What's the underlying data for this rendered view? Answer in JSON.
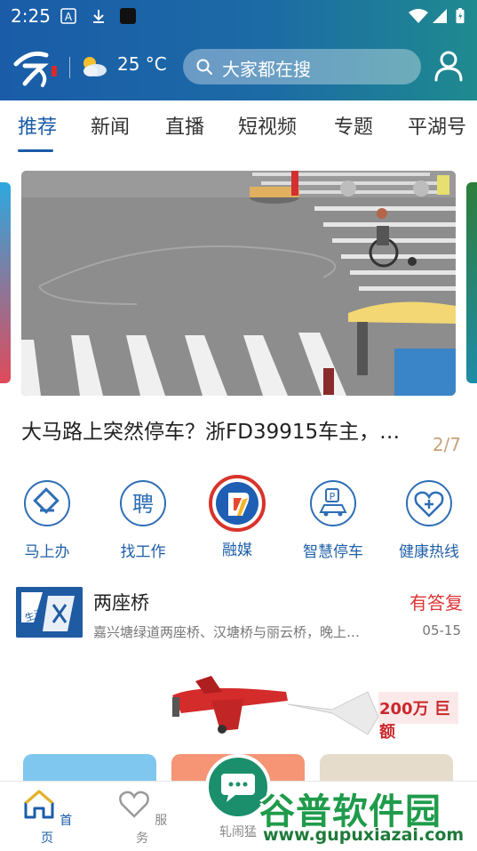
{
  "status_bar": {
    "time": "2:25",
    "icons": [
      "a-icon",
      "download-icon",
      "square-icon",
      "wifi-icon",
      "signal-icon",
      "battery-icon"
    ]
  },
  "header": {
    "logo_icon": "jiaxing-logo-icon",
    "weather_icon": "partly-cloudy-icon",
    "temperature": "25 °C",
    "search_placeholder": "大家都在搜",
    "user_icon": "user-icon"
  },
  "tabs": [
    {
      "label": "推荐",
      "active": true
    },
    {
      "label": "新闻"
    },
    {
      "label": "直播"
    },
    {
      "label": "短视频"
    },
    {
      "label": "专题"
    },
    {
      "label": "平湖号"
    }
  ],
  "banner": {
    "headline": "大马路上突然停车？浙FD39915车主，…",
    "pager": "2/7"
  },
  "services": [
    {
      "label": "马上办",
      "icon": "diamond-stamp-icon"
    },
    {
      "label": "找工作",
      "icon": "hire-icon",
      "glyph": "聘"
    },
    {
      "label": "融媒",
      "icon": "rongmei-icon"
    },
    {
      "label": "智慧停车",
      "icon": "parking-car-icon"
    },
    {
      "label": "健康热线",
      "icon": "health-heart-icon"
    }
  ],
  "news_item": {
    "thumb_text": "生活 热线",
    "title": "两座桥",
    "badge": "有答复",
    "desc": "嘉兴塘绿道两座桥、汉塘桥与丽云桥，晚上…",
    "date": "05-15"
  },
  "ad": {
    "text": "200万 巨额"
  },
  "bottom_nav": [
    {
      "label": "首页",
      "icon": "home-icon",
      "active": true
    },
    {
      "label": "服务",
      "icon": "heart-icon"
    },
    {
      "label": "轧闹猛",
      "icon": "chat-bubble-icon"
    }
  ],
  "watermark": {
    "brand": "谷普软件园",
    "url": "www.gupuxiazai.com"
  },
  "colors": {
    "brand_blue": "#1a5ca8",
    "header_teal": "#1f8a8f",
    "badge_red": "#d33333",
    "pager_tan": "#c9a27a"
  }
}
